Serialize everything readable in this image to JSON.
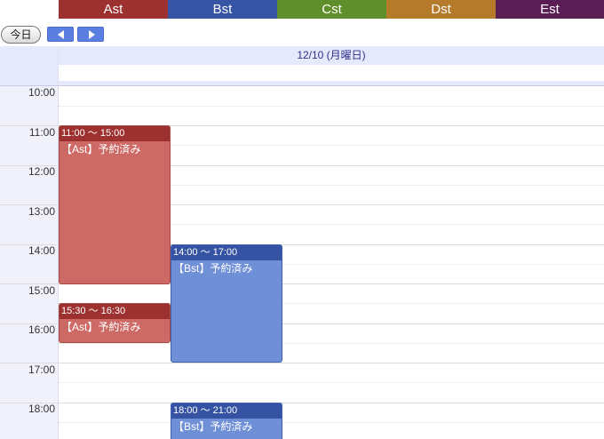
{
  "resources": [
    {
      "name": "Ast",
      "color": "#9c3130"
    },
    {
      "name": "Bst",
      "color": "#3654a4"
    },
    {
      "name": "Cst",
      "color": "#5f8f2a"
    },
    {
      "name": "Dst",
      "color": "#b57b2b"
    },
    {
      "name": "Est",
      "color": "#5a1d54"
    }
  ],
  "toolbar": {
    "today_label": "今日",
    "prev_icon": "chevron-left-icon",
    "next_icon": "chevron-right-icon"
  },
  "day_header": {
    "date_label": "12/10 (月曜日)"
  },
  "times": [
    "10:00",
    "11:00",
    "12:00",
    "13:00",
    "14:00",
    "15:00",
    "16:00",
    "17:00",
    "18:00"
  ],
  "events": [
    {
      "time": "11:00 〜 15:00",
      "title": "【Ast】予約済み",
      "resource": "Ast"
    },
    {
      "time": "14:00 〜 17:00",
      "title": "【Bst】予約済み",
      "resource": "Bst"
    },
    {
      "time": "15:30 〜 16:30",
      "title": "【Ast】予約済み",
      "resource": "Ast"
    },
    {
      "time": "18:00 〜 21:00",
      "title": "【Bst】予約済み",
      "resource": "Bst"
    }
  ]
}
